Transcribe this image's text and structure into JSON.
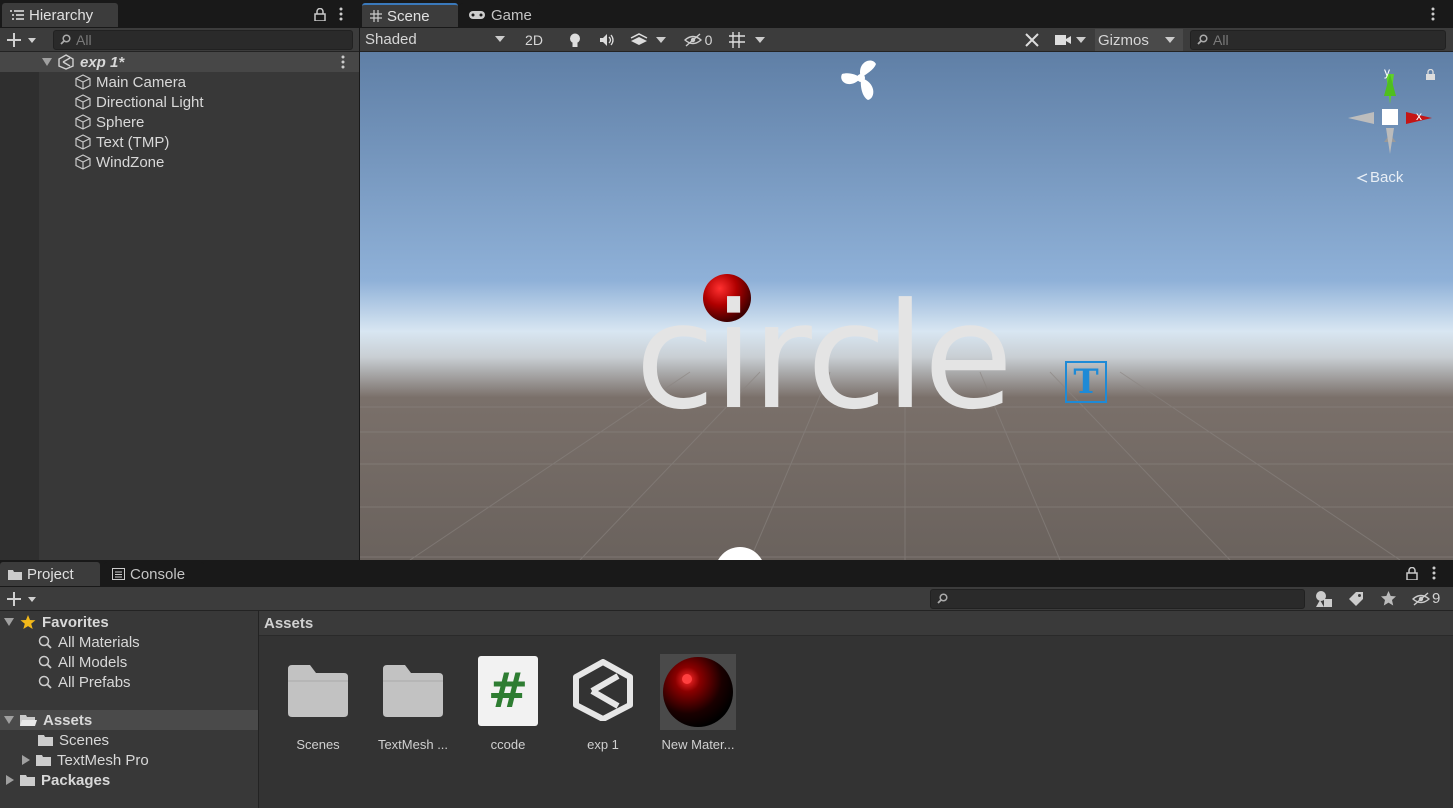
{
  "hierarchy": {
    "tab_label": "Hierarchy",
    "search_placeholder": "All",
    "scene_name": "exp 1*",
    "items": [
      "Main Camera",
      "Directional Light",
      "Sphere",
      "Text (TMP)",
      "WindZone"
    ]
  },
  "scene_view": {
    "tabs": [
      "Scene",
      "Game"
    ],
    "shading_mode": "Shaded",
    "btn_2d": "2D",
    "hidden_count": "0",
    "gizmos_label": "Gizmos",
    "search_placeholder": "All",
    "scene_text": "circle",
    "gizmo_y": "y",
    "gizmo_x": "x",
    "back_label": "Back",
    "tmp_icon_letter": "T"
  },
  "project": {
    "tabs": [
      "Project",
      "Console"
    ],
    "hidden_count": "9",
    "favorites_label": "Favorites",
    "favorites": [
      "All Materials",
      "All Models",
      "All Prefabs"
    ],
    "assets_label": "Assets",
    "asset_folders": [
      "Scenes",
      "TextMesh Pro"
    ],
    "packages_label": "Packages",
    "breadcrumb": "Assets",
    "assets": [
      {
        "name": "Scenes",
        "icon": "folder-icon"
      },
      {
        "name": "TextMesh ...",
        "icon": "folder-icon"
      },
      {
        "name": "ccode",
        "icon": "csharp-script-icon"
      },
      {
        "name": "exp 1",
        "icon": "unity-scene-icon"
      },
      {
        "name": "New Mater...",
        "icon": "material-icon"
      }
    ],
    "script_glyph": "#"
  },
  "colors": {
    "accent_blue": "#3a79bb",
    "sphere_red": "#c00000",
    "tmp_blue": "#1e8ad6"
  }
}
